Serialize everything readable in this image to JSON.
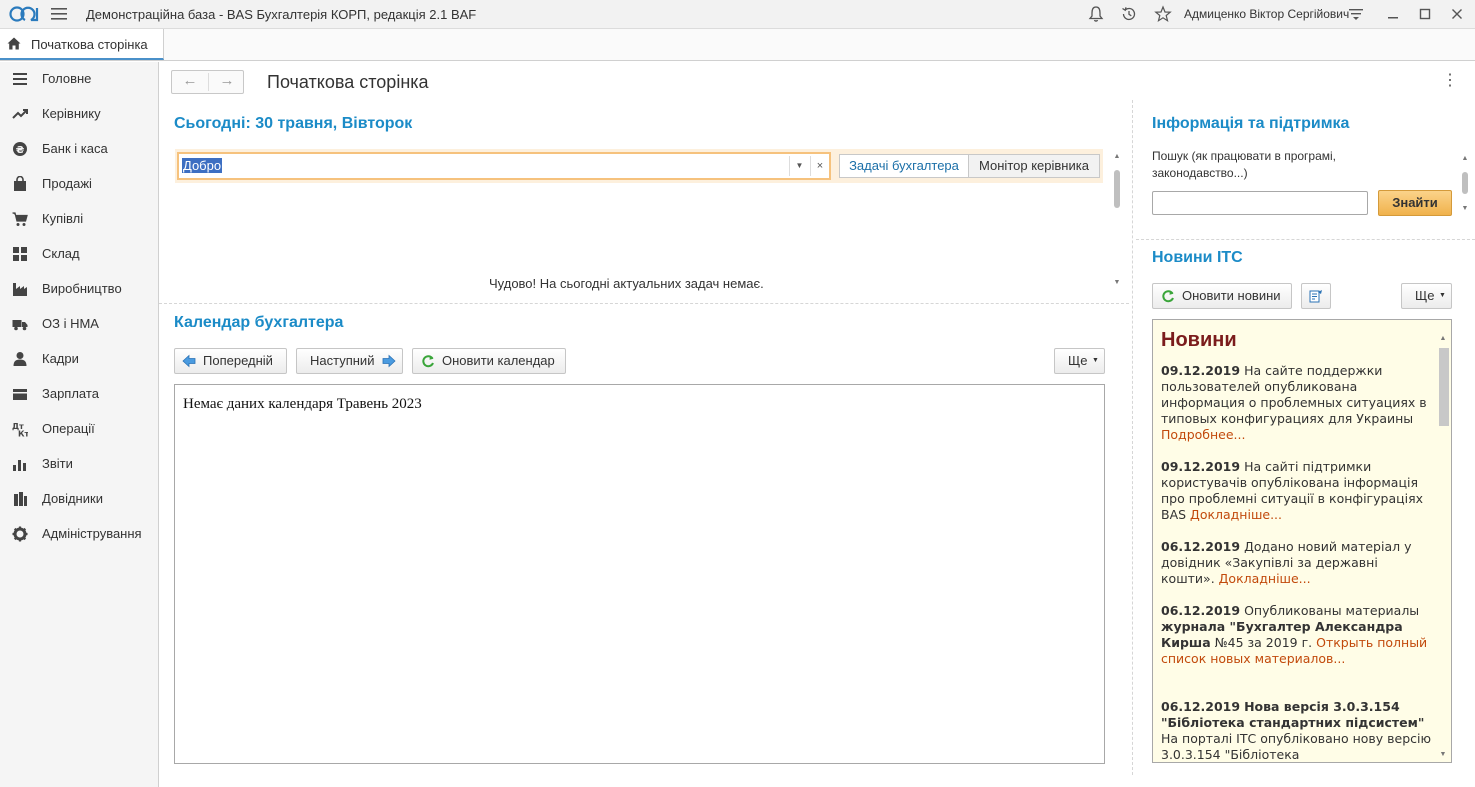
{
  "window": {
    "title": "Демонстраційна база - BAS Бухгалтерія КОРП, редакція 2.1 BAF",
    "user": "Адмиценко Віктор Сергійович"
  },
  "tabs": [
    {
      "label": "Початкова сторінка",
      "active": true,
      "icon": "home-icon"
    }
  ],
  "sidebar": {
    "items": [
      {
        "label": "Головне",
        "icon": "menu-lines-icon"
      },
      {
        "label": "Керівнику",
        "icon": "trend-icon"
      },
      {
        "label": "Банк і каса",
        "icon": "coin-icon"
      },
      {
        "label": "Продажі",
        "icon": "bag-icon"
      },
      {
        "label": "Купівлі",
        "icon": "cart-icon"
      },
      {
        "label": "Склад",
        "icon": "grid-icon"
      },
      {
        "label": "Виробництво",
        "icon": "factory-icon"
      },
      {
        "label": "ОЗ і НМА",
        "icon": "truck-icon"
      },
      {
        "label": "Кадри",
        "icon": "person-icon"
      },
      {
        "label": "Зарплата",
        "icon": "wallet-icon"
      },
      {
        "label": "Операції",
        "icon": "dt-kt-icon"
      },
      {
        "label": "Звіти",
        "icon": "bar-chart-icon"
      },
      {
        "label": "Довідники",
        "icon": "books-icon"
      },
      {
        "label": "Адміністрування",
        "icon": "gear-icon"
      }
    ]
  },
  "page": {
    "title": "Початкова сторінка"
  },
  "today": {
    "heading": "Сьогодні: 30 травня, Вівторок",
    "filter_value": "Добро",
    "tab_accountant": "Задачі бухгалтера",
    "tab_manager": "Монітор керівника",
    "empty_message": "Чудово! На сьогодні актуальних задач немає."
  },
  "calendar": {
    "heading": "Календар бухгалтера",
    "prev_label": "Попередній",
    "next_label": "Наступний",
    "refresh_label": "Оновити календар",
    "more_label": "Ще",
    "empty_text": "Немає даних календаря Травень 2023"
  },
  "info": {
    "heading": "Інформація та підтримка",
    "search_hint": "Пошук (як працювати в програмі, законодавство...)",
    "search_value": "",
    "find_label": "Знайти"
  },
  "news": {
    "heading": "Новини ІТС",
    "refresh_label": "Оновити новини",
    "more_label": "Ще",
    "panel_title": "Новини",
    "items": [
      {
        "date": "09.12.2019",
        "text": "На сайте поддержки пользователей опубликована информация о проблемных ситуациях в типовых конфигурациях для Украины",
        "link": "Подробнее..."
      },
      {
        "date": "09.12.2019",
        "text": "На сайті підтримки користувачів опублікована інформація про проблемні ситуації в конфігураціях BAS",
        "link": "Докладніше..."
      },
      {
        "date": "06.12.2019",
        "text": "Додано новий матеріал у довідник «Закупівлі за державні кошти».",
        "link": "Докладніше..."
      },
      {
        "date": "06.12.2019",
        "text_before": "Опубликованы материалы",
        "bold": "журнала \"Бухгалтер Александра Кирша",
        "text_after": "№45 за 2019 г.",
        "link": "Открыть полный список новых материалов..."
      },
      {
        "date": "06.12.2019",
        "bold": "Нова версія 3.0.3.154 \"Бібліотека стандартних підсистем\"",
        "text": "На порталі ІТС опубліковано нову версію 3.0.3.154 \"Бібліотека"
      }
    ]
  }
}
